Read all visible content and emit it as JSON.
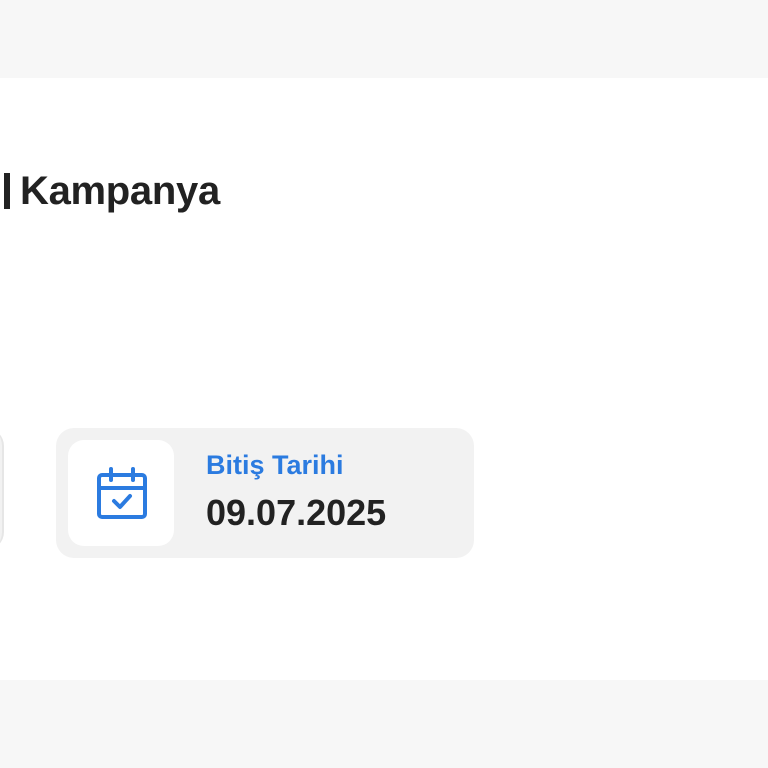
{
  "campaign": {
    "title": "Kampanya"
  },
  "end_date": {
    "label": "Bitiş Tarihi",
    "value": "09.07.2025",
    "icon": "calendar-check-icon"
  },
  "colors": {
    "accent": "#2b7be0",
    "text": "#222222",
    "tile_bg": "#f2f2f2",
    "page_bg": "#f7f7f7"
  }
}
